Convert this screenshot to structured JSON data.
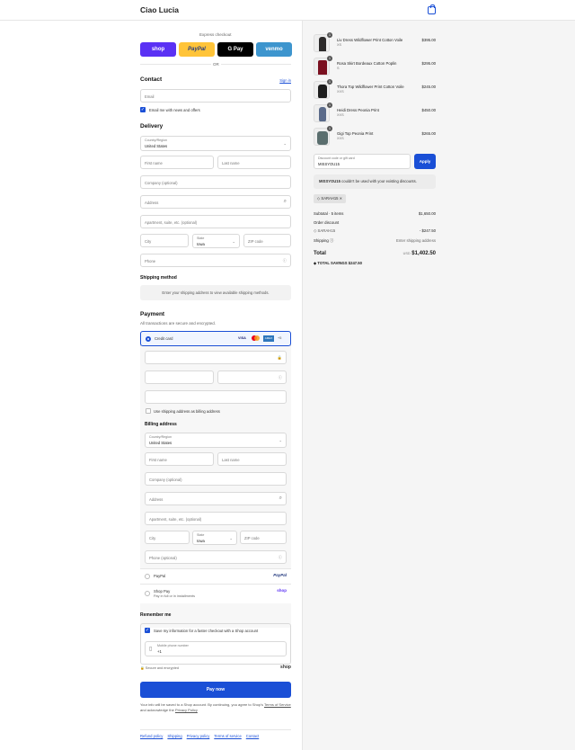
{
  "header": {
    "brand": "Ciao Lucia",
    "cart_icon": "shopping-bag-icon"
  },
  "express": {
    "label": "Express checkout",
    "or": "OR",
    "buttons": [
      {
        "label": "shop",
        "color": "#5a31f4"
      },
      {
        "label": "PayPal",
        "color": "#ffc439"
      },
      {
        "label": "G Pay",
        "color": "#000000"
      },
      {
        "label": "venmo",
        "color": "#3d95ce"
      }
    ]
  },
  "contact": {
    "title": "Contact",
    "sign_in": "Sign in",
    "email_placeholder": "Email",
    "news_label": "Email me with news and offers"
  },
  "delivery": {
    "title": "Delivery",
    "country_label": "Country/Region",
    "country": "United States",
    "first": "First name",
    "last": "Last name",
    "company": "Company (optional)",
    "address": "Address",
    "apt": "Apartment, suite, etc. (optional)",
    "city": "City",
    "state_label": "State",
    "state": "Iowa",
    "zip": "ZIP code",
    "phone": "Phone"
  },
  "shipping": {
    "title": "Shipping method",
    "note": "Enter your shipping address to view available shipping methods."
  },
  "payment": {
    "title": "Payment",
    "subtitle": "All transactions are secure and encrypted.",
    "credit": "Credit card",
    "cards": [
      "VISA",
      "MC",
      "AMEX",
      "+5"
    ],
    "billing_same": "Use shipping address as billing address",
    "billing_title": "Billing address",
    "phone_opt": "Phone (optional)",
    "paypal": "PayPal",
    "paypal_logo": "PayPal",
    "shoppay": "Shop Pay",
    "shoppay_sub": "Pay in full or in installments",
    "shoppay_logo": "shop"
  },
  "remember": {
    "title": "Remember me",
    "save_label": "Save my information for a faster checkout with a Shop account",
    "mobile_label": "Mobile phone number",
    "mobile_value": "+1",
    "secure": "Secure and encrypted",
    "shop_logo": "shop"
  },
  "pay_button": "Pay now",
  "terms": {
    "text": "Your info will be saved to a Shop account. By continuing, you agree to Shop's",
    "tos": "Terms of Service",
    "and": "and acknowledge the",
    "privacy": "Privacy Policy"
  },
  "footer": [
    "Refund policy",
    "Shipping",
    "Privacy policy",
    "Terms of service",
    "Contact"
  ],
  "items": [
    {
      "name": "Liv Dress Wildflower Print Cotton Voile",
      "variant": "XS",
      "price": "$395.00",
      "qty": "1",
      "color": "#2c2a2a"
    },
    {
      "name": "Rosa Skirt Bordeaux Cotton Poplin",
      "variant": "S",
      "price": "$295.00",
      "qty": "1",
      "color": "#7a1020"
    },
    {
      "name": "Thora Top Wildflower Print Cotton Voile",
      "variant": "XXS",
      "price": "$245.00",
      "qty": "1",
      "color": "#1d1d1d"
    },
    {
      "name": "Heidi Dress Peonia Print",
      "variant": "XXS",
      "price": "$450.00",
      "qty": "1",
      "color": "#5b6b8a"
    },
    {
      "name": "Gigi Top Peonia Print",
      "variant": "XXS",
      "price": "$265.00",
      "qty": "1",
      "color": "#5a6e6e"
    }
  ],
  "discount": {
    "label": "Discount code or gift card",
    "value": "MISSYOU15",
    "apply": "Apply",
    "code": "MISSYOU15",
    "error": "couldn't be used with your existing discounts.",
    "tag": "SARAH15"
  },
  "summary": {
    "subtotal_label": "Subtotal · 5 items",
    "subtotal": "$1,650.00",
    "order_discount": "Order discount",
    "code": "SARAH15",
    "discount": "- $247.50",
    "shipping_label": "Shipping",
    "shipping_value": "Enter shipping address",
    "total_label": "Total",
    "currency": "USD",
    "total": "$1,402.50",
    "savings_label": "TOTAL SAVINGS",
    "savings": "$247.50"
  }
}
